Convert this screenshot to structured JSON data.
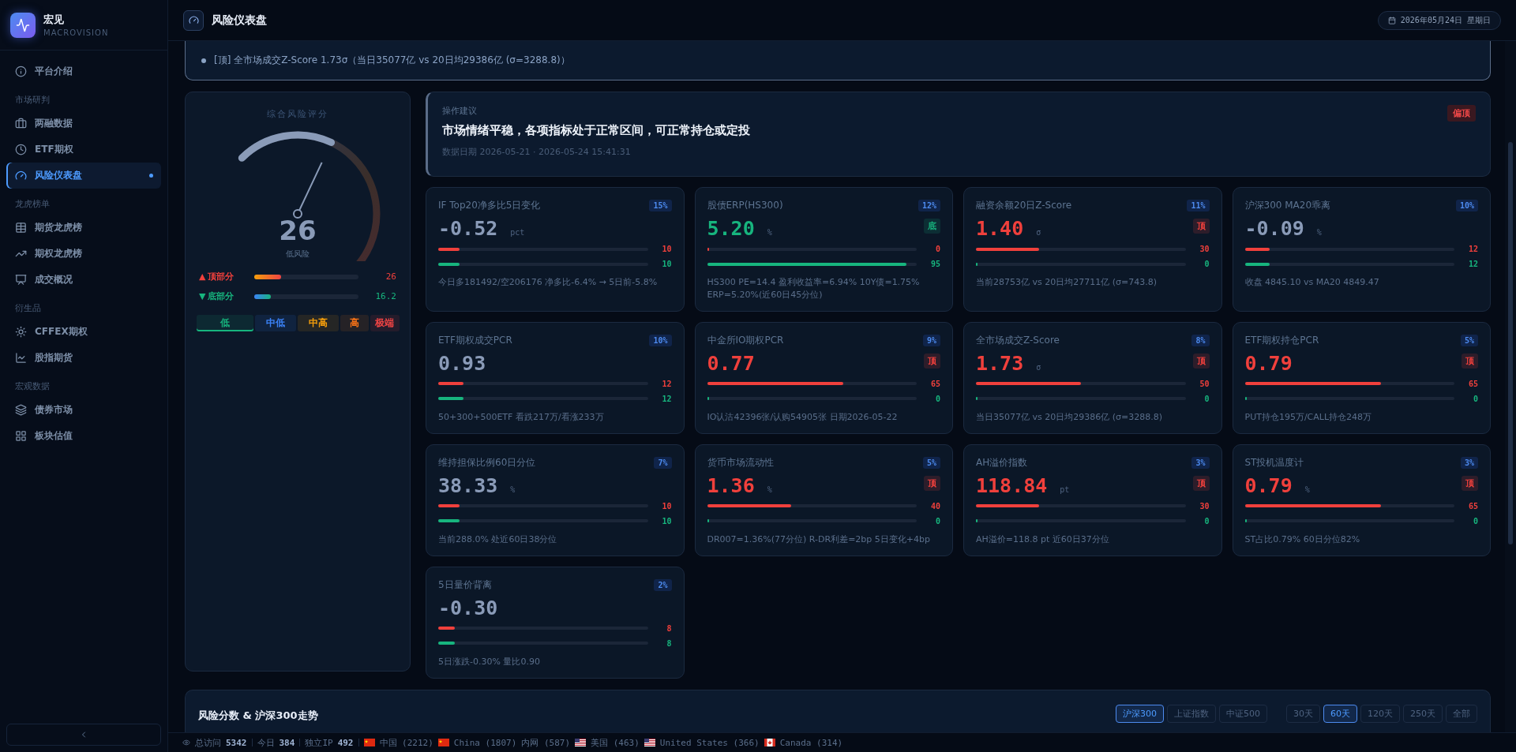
{
  "brand": {
    "name": "宏见",
    "sub": "MACROVISION"
  },
  "sidebar": [
    {
      "label": "平台介绍",
      "selected": false
    },
    {
      "section": "市场研判",
      "items": [
        {
          "label": "两融数据",
          "selected": false
        },
        {
          "label": "ETF期权",
          "selected": false
        },
        {
          "label": "风险仪表盘",
          "selected": true
        }
      ]
    },
    {
      "section": "龙虎榜单",
      "items": [
        {
          "label": "期货龙虎榜",
          "selected": false
        },
        {
          "label": "期权龙虎榜",
          "selected": false
        },
        {
          "label": "成交概况",
          "selected": false
        }
      ]
    },
    {
      "section": "衍生品",
      "items": [
        {
          "label": "CFFEX期权",
          "selected": false
        },
        {
          "label": "股指期货",
          "selected": false
        }
      ]
    },
    {
      "section": "宏观数据",
      "items": [
        {
          "label": "债券市场",
          "selected": false
        },
        {
          "label": "板块估值",
          "selected": false
        }
      ]
    }
  ],
  "header": {
    "title": "风险仪表盘",
    "date": "2026年05月24日 星期日"
  },
  "alerts": [
    "[顶] 全市场成交Z-Score 1.73σ（当日35077亿 vs 20日均29386亿 (σ=3288.8)）"
  ],
  "gauge": {
    "title": "综合风险评分",
    "score": "26",
    "label": "低风险",
    "top": {
      "symbol": "▲",
      "label": "顶部分",
      "value": "26",
      "level": 0.26
    },
    "bottom": {
      "symbol": "▼",
      "label": "底部分",
      "value": "16.2",
      "level": 0.162
    },
    "zones": [
      {
        "label": "低",
        "selected": true,
        "color": "#17b57e"
      },
      {
        "label": "中低",
        "selected": false,
        "color": "#3b82f6"
      },
      {
        "label": "中高",
        "selected": false,
        "color": "#f59e0b"
      },
      {
        "label": "高",
        "selected": false,
        "color": "#f97316"
      },
      {
        "label": "极端",
        "selected": false,
        "color": "#ef4444"
      }
    ]
  },
  "advice": {
    "label": "操作建议",
    "text": "市场情绪平稳，各项指标处于正常区间，可正常持仓或定投",
    "date": "数据日期 2026-05-21 · 2026-05-24 15:41:31",
    "badge": "偏顶"
  },
  "cards": [
    {
      "title": "IF Top20净多比5日变化",
      "weight": "15%",
      "value": "-0.52",
      "unit": "pct",
      "top": {
        "value": "10",
        "level": 0.1
      },
      "bottom": {
        "value": "10",
        "level": 0.1
      },
      "note": "今日多181492/空206176 净多比-6.4% → 5日前-5.8%"
    },
    {
      "title": "股债ERP(HS300)",
      "weight": "12%",
      "value": "5.20",
      "unit": "%",
      "tag": {
        "text": "底",
        "kind": "bottom"
      },
      "top": {
        "value": "0",
        "level": 0
      },
      "bottom": {
        "value": "95",
        "level": 0.95
      },
      "note": "HS300 PE=14.4 盈利收益率=6.94% 10Y债=1.75% ERP=5.20%(近60日45分位)"
    },
    {
      "title": "融资余额20日Z-Score",
      "weight": "11%",
      "value": "1.40",
      "unit": "σ",
      "tag": {
        "text": "顶",
        "kind": "top"
      },
      "top": {
        "value": "30",
        "level": 0.3
      },
      "bottom": {
        "value": "0",
        "level": 0
      },
      "note": "当前28753亿 vs 20日均27711亿 (σ=743.8)"
    },
    {
      "title": "沪深300 MA20乖离",
      "weight": "10%",
      "value": "-0.09",
      "unit": "%",
      "top": {
        "value": "12",
        "level": 0.12
      },
      "bottom": {
        "value": "12",
        "level": 0.12
      },
      "note": "收盘 4845.10 vs MA20 4849.47"
    },
    {
      "title": "ETF期权成交PCR",
      "weight": "10%",
      "value": "0.93",
      "top": {
        "value": "12",
        "level": 0.12
      },
      "bottom": {
        "value": "12",
        "level": 0.12
      },
      "note": "50+300+500ETF 看跌217万/看涨233万"
    },
    {
      "title": "中金所IO期权PCR",
      "weight": "9%",
      "value": "0.77",
      "tag": {
        "text": "顶",
        "kind": "top"
      },
      "top": {
        "value": "65",
        "level": 0.65
      },
      "bottom": {
        "value": "0",
        "level": 0
      },
      "note": "IO认沽42396张/认购54905张 日期2026-05-22"
    },
    {
      "title": "全市场成交Z-Score",
      "weight": "8%",
      "value": "1.73",
      "unit": "σ",
      "tag": {
        "text": "顶",
        "kind": "top"
      },
      "top": {
        "value": "50",
        "level": 0.5
      },
      "bottom": {
        "value": "0",
        "level": 0
      },
      "note": "当日35077亿 vs 20日均29386亿 (σ=3288.8)"
    },
    {
      "title": "ETF期权持仓PCR",
      "weight": "5%",
      "value": "0.79",
      "tag": {
        "text": "顶",
        "kind": "top"
      },
      "top": {
        "value": "65",
        "level": 0.65
      },
      "bottom": {
        "value": "0",
        "level": 0
      },
      "note": "PUT持仓195万/CALL持仓248万"
    },
    {
      "title": "维持担保比例60日分位",
      "weight": "7%",
      "value": "38.33",
      "unit": "%",
      "top": {
        "value": "10",
        "level": 0.1
      },
      "bottom": {
        "value": "10",
        "level": 0.1
      },
      "note": "当前288.0% 处近60日38分位"
    },
    {
      "title": "货币市场流动性",
      "weight": "5%",
      "value": "1.36",
      "unit": "%",
      "tag": {
        "text": "顶",
        "kind": "top"
      },
      "top": {
        "value": "40",
        "level": 0.4
      },
      "bottom": {
        "value": "0",
        "level": 0
      },
      "note": "DR007=1.36%(77分位) R-DR利差=2bp 5日变化+4bp"
    },
    {
      "title": "AH溢价指数",
      "weight": "3%",
      "value": "118.84",
      "unit": "pt",
      "tag": {
        "text": "顶",
        "kind": "top"
      },
      "top": {
        "value": "30",
        "level": 0.3
      },
      "bottom": {
        "value": "0",
        "level": 0
      },
      "note": "AH溢价=118.8 pt 近60日37分位"
    },
    {
      "title": "ST投机温度计",
      "weight": "3%",
      "value": "0.79",
      "unit": "%",
      "tag": {
        "text": "顶",
        "kind": "top"
      },
      "top": {
        "value": "65",
        "level": 0.65
      },
      "bottom": {
        "value": "0",
        "level": 0
      },
      "note": "ST占比0.79% 60日分位82%"
    },
    {
      "title": "5日量价背离",
      "weight": "2%",
      "value": "-0.30",
      "top": {
        "value": "8",
        "level": 0.08
      },
      "bottom": {
        "value": "8",
        "level": 0.08
      },
      "note": "5日涨跌-0.30% 量比0.90"
    }
  ],
  "chart_panel": {
    "title": "风险分数 & 沪深300走势",
    "indices": [
      {
        "label": "沪深300",
        "selected": true
      },
      {
        "label": "上证指数",
        "selected": false
      },
      {
        "label": "中证500",
        "selected": false
      }
    ],
    "ranges": [
      {
        "label": "30天",
        "selected": false
      },
      {
        "label": "60天",
        "selected": true
      },
      {
        "label": "120天",
        "selected": false
      },
      {
        "label": "250天",
        "selected": false
      },
      {
        "label": "全部",
        "selected": false
      }
    ]
  },
  "status_bar": {
    "stats": [
      {
        "label": "总访问",
        "value": "5342"
      },
      {
        "label": "今日",
        "value": "384"
      },
      {
        "label": "独立IP",
        "value": "492"
      }
    ],
    "visitors": [
      "中国 (2212)",
      "China (1807)",
      "内网 (587)",
      "美国 (463)",
      "United States (366)",
      "Canada (314)"
    ]
  }
}
